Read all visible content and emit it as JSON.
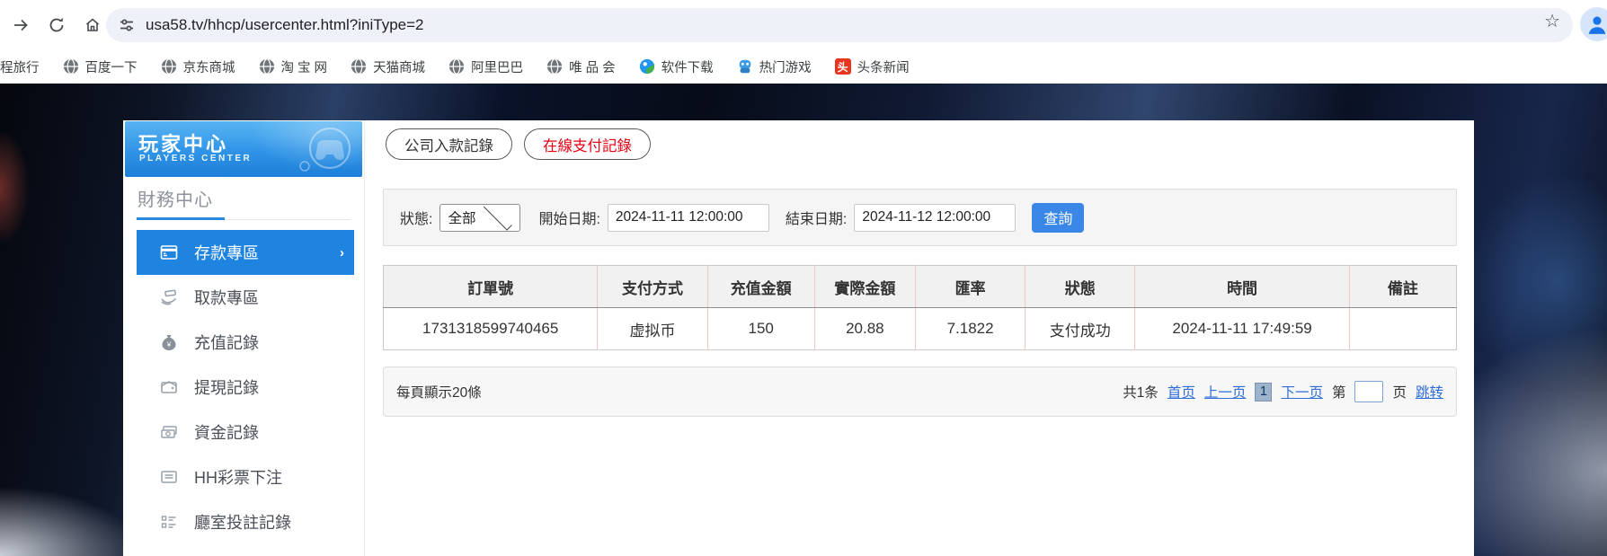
{
  "browser": {
    "toolbar": {
      "url": "usa58.tv/hhcp/usercenter.html?iniType=2"
    },
    "bookmarks": [
      {
        "label": "程旅行"
      },
      {
        "label": "百度一下"
      },
      {
        "label": "京东商城"
      },
      {
        "label": "淘 宝 网"
      },
      {
        "label": "天猫商城"
      },
      {
        "label": "阿里巴巴"
      },
      {
        "label": "唯 品 会"
      },
      {
        "label": "软件下载"
      },
      {
        "label": "热门游戏"
      },
      {
        "label": "头条新闻",
        "badge_glyph": "头"
      }
    ]
  },
  "sidebar": {
    "title": "玩家中心",
    "subtitle": "PLAYERS CENTER",
    "section": "財務中心",
    "active_chevron": "›",
    "recharge_glyph": "¥",
    "items": [
      {
        "label": "存款專區"
      },
      {
        "label": "取款專區"
      },
      {
        "label": "充值記錄"
      },
      {
        "label": "提現記錄"
      },
      {
        "label": "資金記錄"
      },
      {
        "label": "HH彩票下注"
      },
      {
        "label": "廳室投註記錄"
      }
    ]
  },
  "main": {
    "tabs": [
      {
        "label": "公司入款記錄"
      },
      {
        "label": "在線支付記錄"
      }
    ],
    "filters": {
      "status_label": "狀態:",
      "status_value": "全部",
      "start_label": "開始日期:",
      "start_value": "2024-11-11 12:00:00",
      "end_label": "結束日期:",
      "end_value": "2024-11-12 12:00:00",
      "search_label": "查詢"
    },
    "table": {
      "headers": [
        "訂單號",
        "支付方式",
        "充值金額",
        "實際金額",
        "匯率",
        "狀態",
        "時間",
        "備註"
      ],
      "rows": [
        [
          "1731318599740465",
          "虚拟币",
          "150",
          "20.88",
          "7.1822",
          "支付成功",
          "2024-11-11 17:49:59",
          ""
        ]
      ]
    },
    "pagination": {
      "page_size_text": "每頁顯示20條",
      "total_text": "共1条",
      "first_label": "首页",
      "prev_label": "上一页",
      "current_page": "1",
      "next_label": "下一页",
      "jump_prefix": "第",
      "jump_suffix": "页",
      "jump_label": "跳转"
    }
  },
  "colors": {
    "sidebar_active_blue": "#1f83e0",
    "banner_blue": "#2f93e6",
    "query_button_blue": "#3b87e8",
    "link_blue": "#2e6cd9",
    "active_tab_red": "#e60012",
    "table_divider_pink": "#f0c6c6"
  }
}
